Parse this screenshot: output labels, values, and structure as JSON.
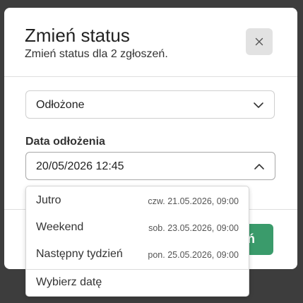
{
  "dialog": {
    "title": "Zmień status",
    "subtitle": "Zmień status dla 2 zgłoszeń.",
    "close_icon": "close-icon"
  },
  "status_select": {
    "value": "Odłożone",
    "icon": "chevron-down-icon"
  },
  "postpone_date": {
    "label": "Data odłożenia",
    "value": "20/05/2026 12:45",
    "icon": "chevron-up-icon"
  },
  "confirm_button": {
    "label": "ń",
    "color": "#3a9b6b"
  },
  "dropdown": {
    "options": [
      {
        "label": "Jutro",
        "date": "czw. 21.05.2026, 09:00"
      },
      {
        "label": "Weekend",
        "date": "sob. 23.05.2026, 09:00"
      },
      {
        "label": "Następny tydzień",
        "date": "pon. 25.05.2026, 09:00"
      }
    ],
    "pick_date_label": "Wybierz datę"
  }
}
